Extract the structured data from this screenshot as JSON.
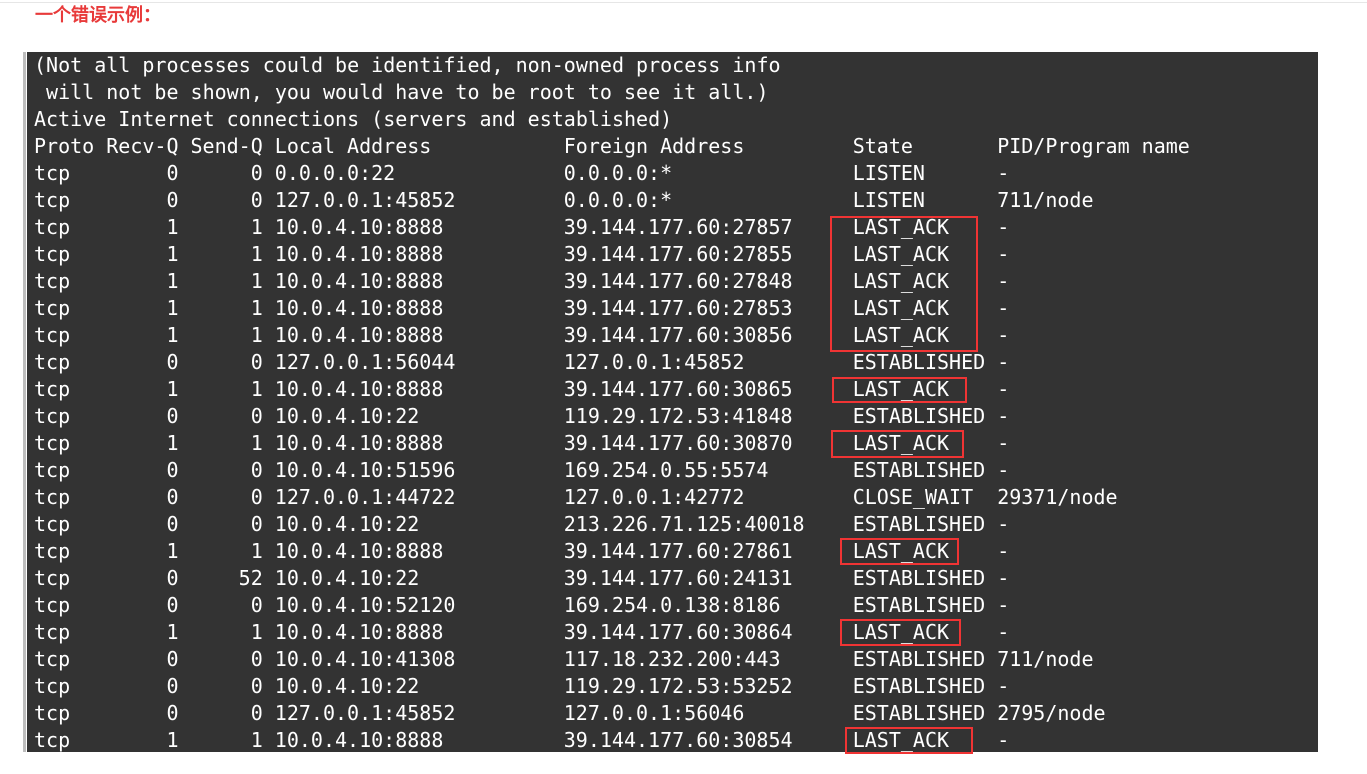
{
  "heading": "一个错误示例：",
  "colors": {
    "terminal_bg": "#333333",
    "text": "#ffffff",
    "heading": "#e83a3a",
    "highlight_box": "#f03434"
  },
  "terminal": {
    "preamble": [
      "(Not all processes could be identified, non-owned process info",
      " will not be shown, you would have to be root to see it all.)",
      "Active Internet connections (servers and established)"
    ],
    "columns": [
      "Proto",
      "Recv-Q",
      "Send-Q",
      "Local Address",
      "Foreign Address",
      "State",
      "PID/Program name"
    ],
    "rows": [
      [
        "tcp",
        "0",
        "0",
        "0.0.0.0:22",
        "0.0.0.0:*",
        "LISTEN",
        "-"
      ],
      [
        "tcp",
        "0",
        "0",
        "127.0.0.1:45852",
        "0.0.0.0:*",
        "LISTEN",
        "711/node"
      ],
      [
        "tcp",
        "1",
        "1",
        "10.0.4.10:8888",
        "39.144.177.60:27857",
        "LAST_ACK",
        "-"
      ],
      [
        "tcp",
        "1",
        "1",
        "10.0.4.10:8888",
        "39.144.177.60:27855",
        "LAST_ACK",
        "-"
      ],
      [
        "tcp",
        "1",
        "1",
        "10.0.4.10:8888",
        "39.144.177.60:27848",
        "LAST_ACK",
        "-"
      ],
      [
        "tcp",
        "1",
        "1",
        "10.0.4.10:8888",
        "39.144.177.60:27853",
        "LAST_ACK",
        "-"
      ],
      [
        "tcp",
        "1",
        "1",
        "10.0.4.10:8888",
        "39.144.177.60:30856",
        "LAST_ACK",
        "-"
      ],
      [
        "tcp",
        "0",
        "0",
        "127.0.0.1:56044",
        "127.0.0.1:45852",
        "ESTABLISHED",
        "-"
      ],
      [
        "tcp",
        "1",
        "1",
        "10.0.4.10:8888",
        "39.144.177.60:30865",
        "LAST_ACK",
        "-"
      ],
      [
        "tcp",
        "0",
        "0",
        "10.0.4.10:22",
        "119.29.172.53:41848",
        "ESTABLISHED",
        "-"
      ],
      [
        "tcp",
        "1",
        "1",
        "10.0.4.10:8888",
        "39.144.177.60:30870",
        "LAST_ACK",
        "-"
      ],
      [
        "tcp",
        "0",
        "0",
        "10.0.4.10:51596",
        "169.254.0.55:5574",
        "ESTABLISHED",
        "-"
      ],
      [
        "tcp",
        "0",
        "0",
        "127.0.0.1:44722",
        "127.0.0.1:42772",
        "CLOSE_WAIT",
        "29371/node"
      ],
      [
        "tcp",
        "0",
        "0",
        "10.0.4.10:22",
        "213.226.71.125:40018",
        "ESTABLISHED",
        "-"
      ],
      [
        "tcp",
        "1",
        "1",
        "10.0.4.10:8888",
        "39.144.177.60:27861",
        "LAST_ACK",
        "-"
      ],
      [
        "tcp",
        "0",
        "52",
        "10.0.4.10:22",
        "39.144.177.60:24131",
        "ESTABLISHED",
        "-"
      ],
      [
        "tcp",
        "0",
        "0",
        "10.0.4.10:52120",
        "169.254.0.138:8186",
        "ESTABLISHED",
        "-"
      ],
      [
        "tcp",
        "1",
        "1",
        "10.0.4.10:8888",
        "39.144.177.60:30864",
        "LAST_ACK",
        "-"
      ],
      [
        "tcp",
        "0",
        "0",
        "10.0.4.10:41308",
        "117.18.232.200:443",
        "ESTABLISHED",
        "711/node"
      ],
      [
        "tcp",
        "0",
        "0",
        "10.0.4.10:22",
        "119.29.172.53:53252",
        "ESTABLISHED",
        "-"
      ],
      [
        "tcp",
        "0",
        "0",
        "127.0.0.1:45852",
        "127.0.0.1:56046",
        "ESTABLISHED",
        "2795/node"
      ],
      [
        "tcp",
        "1",
        "1",
        "10.0.4.10:8888",
        "39.144.177.60:30854",
        "LAST_ACK",
        "-"
      ]
    ]
  }
}
